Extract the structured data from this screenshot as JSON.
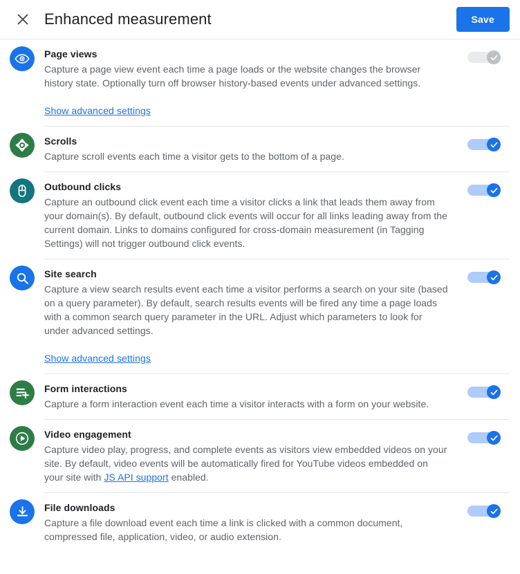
{
  "header": {
    "close_icon": "close-icon",
    "title": "Enhanced measurement",
    "save_label": "Save"
  },
  "colors": {
    "accent_blue": "#1a73e8",
    "track_blue": "#aecbfa",
    "disabled_gray": "#bdc1c6",
    "icon_green": "#2e7d46",
    "icon_teal": "#13757d",
    "text_primary": "#202124",
    "text_secondary": "#5f6368",
    "divider": "#e4e6e8"
  },
  "settings": [
    {
      "title": "Page views",
      "description": "Capture a page view event each time a page loads or the website changes the browser history state. Optionally turn off browser history-based events under advanced settings.",
      "icon": "eye-icon",
      "icon_color": "#1a73e8",
      "toggle_on": true,
      "toggle_disabled": true,
      "advanced_link": "Show advanced settings"
    },
    {
      "title": "Scrolls",
      "description": "Capture scroll events each time a visitor gets to the bottom of a page.",
      "icon": "scroll-move-icon",
      "icon_color": "#2e7d46",
      "toggle_on": true,
      "toggle_disabled": false,
      "advanced_link": null
    },
    {
      "title": "Outbound clicks",
      "description": "Capture an outbound click event each time a visitor clicks a link that leads them away from your domain(s). By default, outbound click events will occur for all links leading away from the current domain. Links to domains configured for cross-domain measurement (in Tagging Settings) will not trigger outbound click events.",
      "icon": "mouse-click-icon",
      "icon_color": "#13757d",
      "toggle_on": true,
      "toggle_disabled": false,
      "advanced_link": null
    },
    {
      "title": "Site search",
      "description": "Capture a view search results event each time a visitor performs a search on your site (based on a query parameter). By default, search results events will be fired any time a page loads with a common search query parameter in the URL. Adjust which parameters to look for under advanced settings.",
      "icon": "search-icon",
      "icon_color": "#1a73e8",
      "toggle_on": true,
      "toggle_disabled": false,
      "advanced_link": "Show advanced settings"
    },
    {
      "title": "Form interactions",
      "description": "Capture a form interaction event each time a visitor interacts with a form on your website.",
      "icon": "form-add-icon",
      "icon_color": "#2e7d46",
      "toggle_on": true,
      "toggle_disabled": false,
      "advanced_link": null
    },
    {
      "title": "Video engagement",
      "description_before_link": "Capture video play, progress, and complete events as visitors view embedded videos on your site. By default, video events will be automatically fired for YouTube videos embedded on your site with ",
      "link_text": "JS API support",
      "description_after_link": " enabled.",
      "icon": "play-circle-icon",
      "icon_color": "#2e7d46",
      "toggle_on": true,
      "toggle_disabled": false,
      "advanced_link": null
    },
    {
      "title": "File downloads",
      "description": "Capture a file download event each time a link is clicked with a common document, compressed file, application, video, or audio extension.",
      "icon": "download-icon",
      "icon_color": "#1a73e8",
      "toggle_on": true,
      "toggle_disabled": false,
      "advanced_link": null
    }
  ]
}
